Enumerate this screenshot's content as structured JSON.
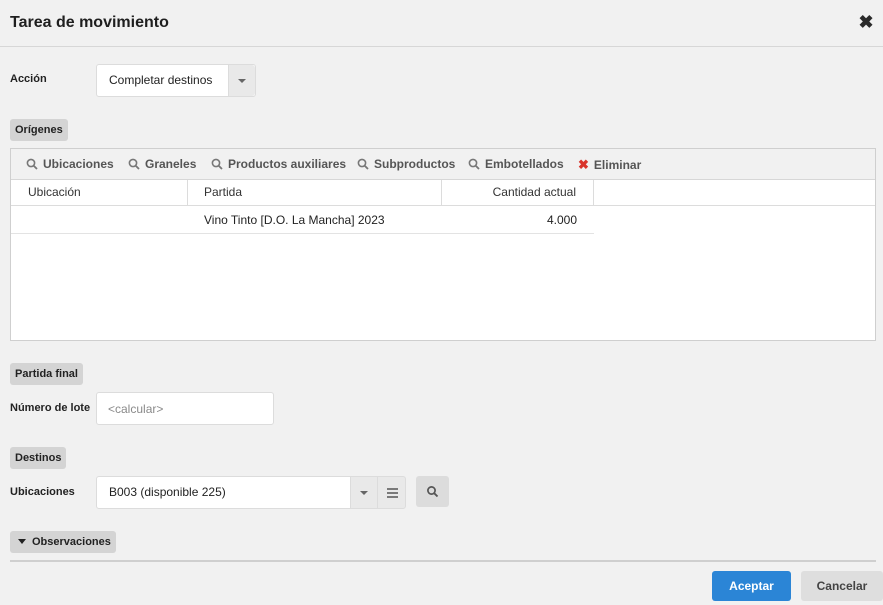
{
  "dialog": {
    "title": "Tarea de movimiento",
    "close_icon": "close-icon"
  },
  "accion": {
    "label": "Acción",
    "value": "Completar destinos"
  },
  "origenes": {
    "section_label": "Orígenes",
    "toolbar": [
      {
        "label": "Ubicaciones",
        "icon": "search-icon"
      },
      {
        "label": "Graneles",
        "icon": "search-icon"
      },
      {
        "label": "Productos auxiliares",
        "icon": "search-icon"
      },
      {
        "label": "Subproductos",
        "icon": "search-icon"
      },
      {
        "label": "Embotellados",
        "icon": "search-icon"
      },
      {
        "label": "Eliminar",
        "icon": "delete-icon"
      }
    ],
    "columns": [
      "Ubicación",
      "Partida",
      "Cantidad actual"
    ],
    "rows": [
      {
        "ubicacion": "",
        "partida": "Vino Tinto [D.O.  La Mancha] 2023",
        "cantidad": "4.000"
      }
    ]
  },
  "partida_final": {
    "section_label": "Partida final",
    "lote_label": "Número de lote",
    "lote_value": "",
    "lote_placeholder": "<calcular>"
  },
  "destinos": {
    "section_label": "Destinos",
    "ubicaciones_label": "Ubicaciones",
    "ubicaciones_value": "B003 (disponible 225)"
  },
  "observaciones": {
    "section_label": "Observaciones"
  },
  "footer": {
    "accept_label": "Aceptar",
    "cancel_label": "Cancelar"
  },
  "colors": {
    "primary": "#2b85d6",
    "danger": "#d9342b",
    "background": "#f1f1f1"
  }
}
